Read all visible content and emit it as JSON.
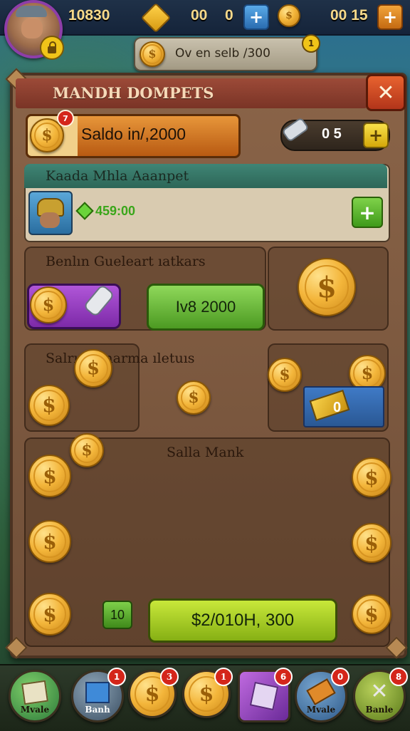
{
  "top_bar": {
    "resource_1_value": "10830",
    "resource_2_value": "00",
    "resource_2b_value": "0",
    "resource_3_value": "00 15"
  },
  "sub_banner": {
    "text": "Ov en selb /300",
    "badge": "1"
  },
  "panel": {
    "title": "MANDH DOMPETS",
    "saldo": {
      "label": "Saldo in/,2000",
      "badge": "7"
    },
    "tickets": {
      "value": "0 5"
    },
    "offer": {
      "title": "Kaada Mhla Aaanpet",
      "value": "459:00"
    },
    "section1": {
      "title": "Benlın Gueleart ıatkars",
      "buy_button": "Iv8 2000"
    },
    "section2": {
      "title": "Salrı Manarma ıletuıs",
      "chest_value": "0"
    },
    "section3": {
      "title": "Salla Mank",
      "small_value": "10",
      "collect_button": "$2/010H, 300"
    }
  },
  "bottom_nav": [
    {
      "label": "Mvale",
      "badge": ""
    },
    {
      "label": "Banh",
      "badge": "1"
    },
    {
      "label": "",
      "badge": "3"
    },
    {
      "label": "",
      "badge": "1"
    },
    {
      "label": "",
      "badge": "6"
    },
    {
      "label": "Mvale",
      "badge": "0"
    },
    {
      "label": "Banle",
      "badge": "8"
    }
  ],
  "colors": {
    "accent_gold": "#f3b53a",
    "panel_brown": "#7a563d",
    "title_red": "#8a3a2c",
    "green_button": "#6cbc38",
    "purple_button": "#9a40c0"
  }
}
